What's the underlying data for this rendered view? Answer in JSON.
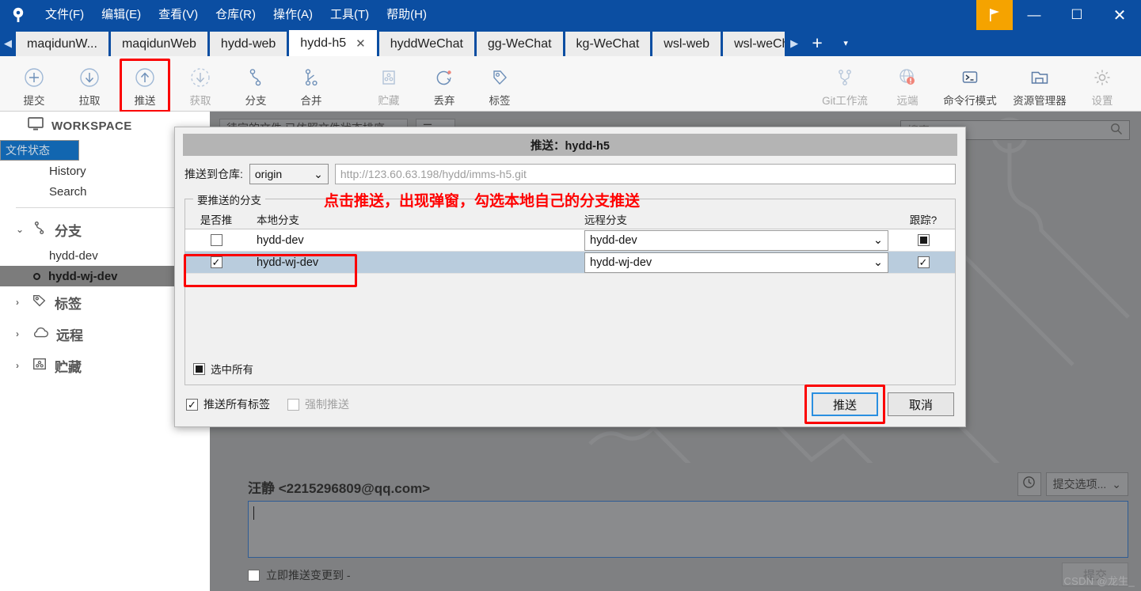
{
  "titlebar": {
    "menus": [
      {
        "label": "文件(F)"
      },
      {
        "label": "编辑(E)"
      },
      {
        "label": "查看(V)"
      },
      {
        "label": "仓库(R)"
      },
      {
        "label": "操作(A)"
      },
      {
        "label": "工具(T)"
      },
      {
        "label": "帮助(H)"
      }
    ],
    "minimize": "—",
    "maximize": "☐",
    "close": "✕",
    "accent_blue": "#0b4ea2",
    "flag_orange": "#f5a300"
  },
  "tabs": {
    "items": [
      {
        "label": "maqidunW...",
        "active": false
      },
      {
        "label": "maqidunWeb",
        "active": false
      },
      {
        "label": "hydd-web",
        "active": false
      },
      {
        "label": "hydd-h5",
        "active": true
      },
      {
        "label": "hyddWeChat",
        "active": false
      },
      {
        "label": "gg-WeChat",
        "active": false
      },
      {
        "label": "kg-WeChat",
        "active": false
      },
      {
        "label": "wsl-web",
        "active": false
      },
      {
        "label": "wsl-weChat",
        "active": false
      }
    ],
    "close_glyph": "✕",
    "add_glyph": "+",
    "overflow_glyph": "▾",
    "scroll_left": "◀",
    "scroll_right": "▶"
  },
  "toolbar": {
    "left_buttons": [
      {
        "label": "提交",
        "icon": "plus-circle-icon",
        "dim": false,
        "highlighted": false
      },
      {
        "label": "拉取",
        "icon": "arrow-down-circle-icon",
        "dim": false,
        "highlighted": false
      },
      {
        "label": "推送",
        "icon": "arrow-up-circle-icon",
        "dim": false,
        "highlighted": true
      },
      {
        "label": "获取",
        "icon": "fetch-dashed-circle-icon",
        "dim": true,
        "highlighted": false
      },
      {
        "label": "分支",
        "icon": "branch-icon",
        "dim": false,
        "highlighted": false
      },
      {
        "label": "合并",
        "icon": "merge-icon",
        "dim": false,
        "highlighted": false
      },
      {
        "label": "贮藏",
        "icon": "stash-box-icon",
        "dim": true,
        "highlighted": false
      },
      {
        "label": "丢弃",
        "icon": "discard-refresh-icon",
        "dim": false,
        "highlighted": false
      },
      {
        "label": "标签",
        "icon": "tag-icon",
        "dim": false,
        "highlighted": false
      }
    ],
    "right_buttons": [
      {
        "label": "Git工作流",
        "icon": "gitflow-icon",
        "dim": true
      },
      {
        "label": "远端",
        "icon": "globe-alert-icon",
        "dim": true
      },
      {
        "label": "命令行模式",
        "icon": "terminal-icon",
        "dim": false
      },
      {
        "label": "资源管理器",
        "icon": "folder-icon",
        "dim": false
      },
      {
        "label": "设置",
        "icon": "gear-icon",
        "dim": true
      }
    ],
    "highlight_color": "#fb0000"
  },
  "sidebar": {
    "workspace_label": "WORKSPACE",
    "workspace_icon": "monitor-icon",
    "items": [
      {
        "label": "文件状态",
        "state": "selected"
      },
      {
        "label": "History",
        "state": "normal"
      },
      {
        "label": "Search",
        "state": "normal"
      }
    ],
    "groups": [
      {
        "label": "分支",
        "icon": "branch-icon",
        "expanded": true,
        "caret": "⌄",
        "children": [
          {
            "label": "hydd-dev",
            "current": false
          },
          {
            "label": "hydd-wj-dev",
            "current": true
          }
        ]
      },
      {
        "label": "标签",
        "icon": "tag-icon",
        "expanded": false,
        "caret": "›",
        "children": []
      },
      {
        "label": "远程",
        "icon": "cloud-icon",
        "expanded": false,
        "caret": "›",
        "children": []
      },
      {
        "label": "贮藏",
        "icon": "stash-box-icon",
        "expanded": false,
        "caret": "›",
        "children": []
      }
    ]
  },
  "right_pane": {
    "file_filter": "待定的文件  已依照文件状态排序",
    "filter_caret": "⌄",
    "list_icon": "list-view-icon",
    "list_caret": "⌄",
    "search_placeholder": "搜索",
    "search_icon": "search-icon",
    "commit_author": "汪静 <2215296809@qq.com>",
    "history_icon": "clock-icon",
    "commit_options_label": "提交选项...",
    "commit_options_caret": "⌄",
    "message_value": "",
    "push_immediately_label": "立即推送变更到 -",
    "push_immediately_checked": false,
    "commit_button": "提交",
    "watermark": "CSDN @龙生_"
  },
  "dialog": {
    "title": "推送：hydd-h5",
    "repo_label": "推送到仓库:",
    "repo_value": "origin",
    "repo_caret": "⌄",
    "repo_url": "http://123.60.63.198/hydd/imms-h5.git",
    "fieldset_legend": "要推送的分支",
    "annotation": "点击推送，出现弹窗，勾选本地自己的分支推送",
    "annotation_color": "#ff0000",
    "columns": [
      "是否推",
      "本地分支",
      "远程分支",
      "跟踪?"
    ],
    "rows": [
      {
        "push_checked": false,
        "local_branch": "hydd-dev",
        "remote_branch": "hydd-dev",
        "track": "partial",
        "selected": false,
        "highlighted": false
      },
      {
        "push_checked": true,
        "local_branch": "hydd-wj-dev",
        "remote_branch": "hydd-wj-dev",
        "track": "checked",
        "selected": true,
        "highlighted": true
      }
    ],
    "select_all_label": "选中所有",
    "select_all_state": "partial",
    "push_all_tags_label": "推送所有标签",
    "push_all_tags_checked": true,
    "force_push_label": "强制推送",
    "force_push_checked": false,
    "force_push_disabled": true,
    "push_button": "推送",
    "cancel_button": "取消",
    "combo_caret": "⌄",
    "check_glyph": "✓"
  }
}
